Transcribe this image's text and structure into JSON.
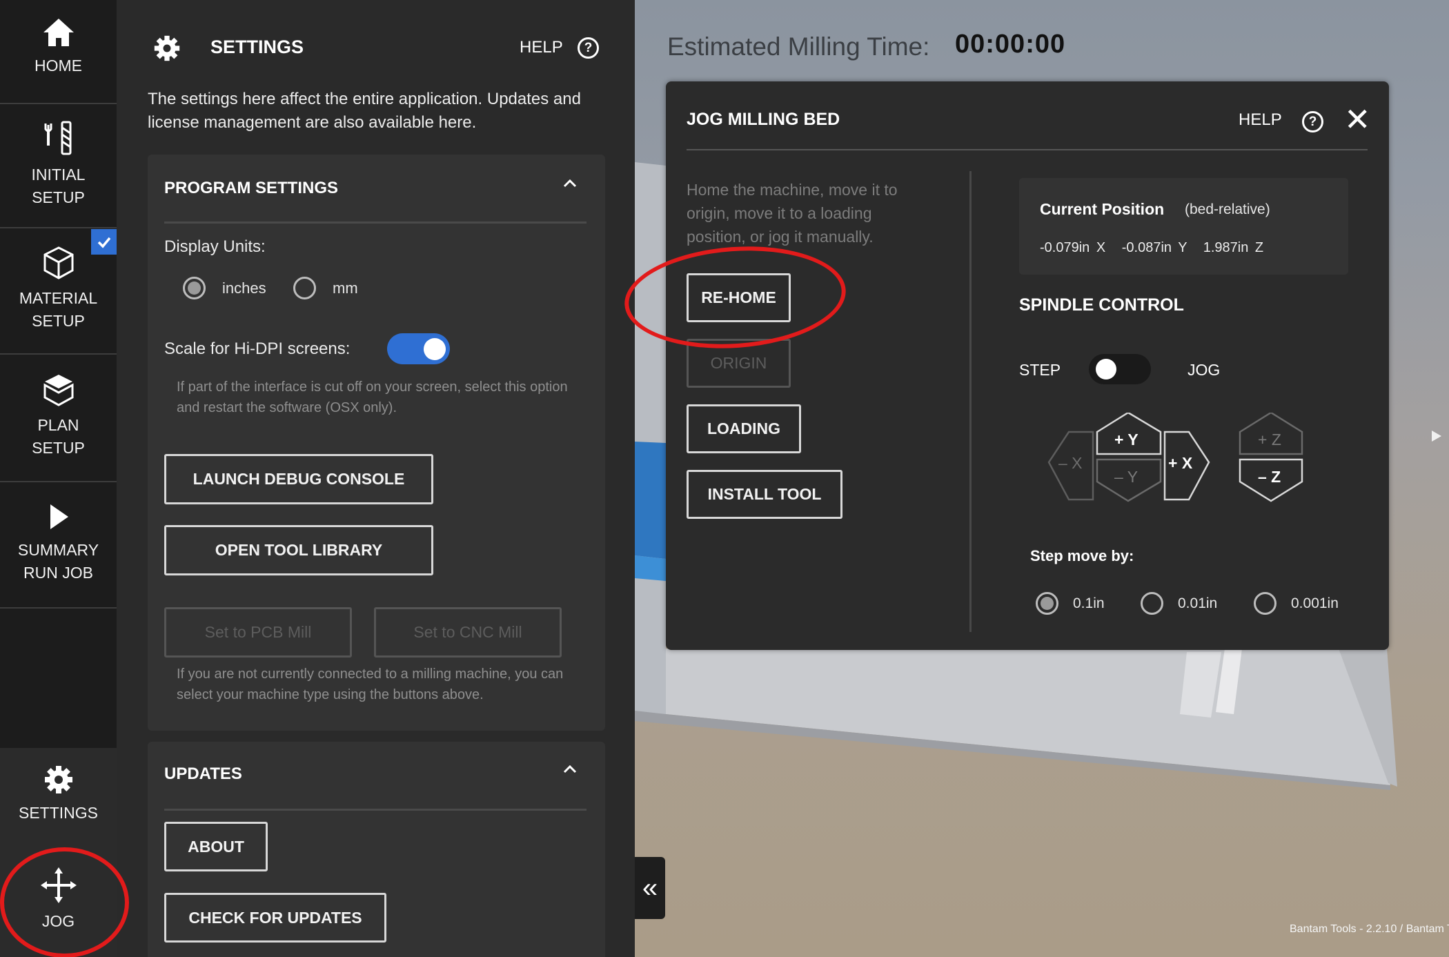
{
  "nav": {
    "items": [
      {
        "label_1": "HOME",
        "label_2": ""
      },
      {
        "label_1": "INITIAL",
        "label_2": "SETUP"
      },
      {
        "label_1": "MATERIAL",
        "label_2": "SETUP"
      },
      {
        "label_1": "PLAN",
        "label_2": "SETUP"
      },
      {
        "label_1": "SUMMARY",
        "label_2": "RUN JOB"
      }
    ],
    "settings_label": "SETTINGS",
    "jog_label": "JOG"
  },
  "settings_panel": {
    "title": "SETTINGS",
    "help_label": "HELP",
    "help_glyph": "?",
    "description": "The settings here affect the entire application. Updates and license management are also available here.",
    "program_settings": {
      "title": "PROGRAM SETTINGS",
      "display_units_label": "Display Units:",
      "units_options": [
        "inches",
        "mm"
      ],
      "units_selected": "inches",
      "hidpi_label": "Scale for Hi-DPI screens:",
      "hidpi_enabled": true,
      "hidpi_note": "If part of the interface is cut off on your screen, select this option and restart the software (OSX only).",
      "launch_debug_console": "LAUNCH DEBUG CONSOLE",
      "open_tool_library": "OPEN TOOL LIBRARY",
      "set_pcb_mill": "Set to PCB Mill",
      "set_cnc_mill": "Set to CNC Mill",
      "machine_note": "If you are not currently connected to a milling machine, you can select your machine type using the buttons above."
    },
    "updates": {
      "title": "UPDATES",
      "about": "ABOUT",
      "check_for_updates": "CHECK FOR UPDATES"
    }
  },
  "viewport": {
    "estimated_label": "Estimated Milling Time:",
    "estimated_value": "00:00:00",
    "collapse_glyph": "«",
    "version": "Bantam Tools - 2.2.10 / Bantam T"
  },
  "jog_dialog": {
    "title": "JOG MILLING BED",
    "help_label": "HELP",
    "help_glyph": "?",
    "close_glyph": "✕",
    "description": "Home the machine, move it to origin, move it to a loading position, or jog it manually.",
    "rehome": "RE-HOME",
    "origin": "ORIGIN",
    "loading": "LOADING",
    "install_tool": "INSTALL TOOL",
    "current_position_label": "Current Position",
    "bed_relative": "(bed-relative)",
    "position": {
      "x": "-0.079in X",
      "y": "-0.087in Y",
      "z": "1.987in Z"
    },
    "spindle_control": "SPINDLE CONTROL",
    "step_label": "STEP",
    "jog_label": "JOG",
    "spindle_mode": "STEP",
    "pad": {
      "minus_x": "– X",
      "plus_y": "+ Y",
      "minus_y": "– Y",
      "plus_x": "+ X",
      "plus_z": "+ Z",
      "minus_z": "– Z"
    },
    "step_move_label": "Step move by:",
    "step_options": [
      "0.1in",
      "0.01in",
      "0.001in"
    ],
    "step_selected": "0.1in"
  },
  "colors": {
    "accent_blue": "#2f6fd3",
    "annotation_red": "#e21b1b",
    "panel_bg": "#2a2a2a"
  }
}
